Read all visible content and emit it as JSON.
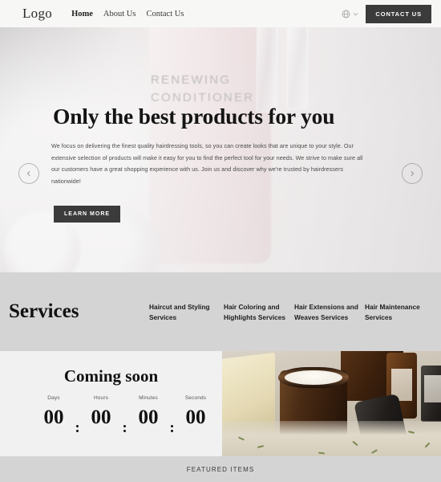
{
  "header": {
    "logo": "Logo",
    "nav": [
      {
        "label": "Home",
        "active": true
      },
      {
        "label": "About Us",
        "active": false
      },
      {
        "label": "Contact Us",
        "active": false
      }
    ],
    "language_icon": "globe-icon",
    "chevron_icon": "chevron-down-icon",
    "cta_label": "CONTACT US"
  },
  "hero": {
    "background_label_line1": "RENEWING",
    "background_label_line2": "CONDITIONER",
    "title": "Only the best products for you",
    "paragraph": "We focus on delivering the finest quality hairdressing tools, so you can create looks that are unique to your style. Our extensive selection of products will make it easy for you to find the perfect tool for your needs. We strive to make sure all our customers have a great shopping experience with us. Join us and discover why we're trusted by hairdressers nationwide!",
    "cta_label": "LEARN MORE",
    "prev_icon": "chevron-left-icon",
    "next_icon": "chevron-right-icon",
    "dots": [
      {
        "active": true
      },
      {
        "active": false
      },
      {
        "active": false
      }
    ]
  },
  "services": {
    "title": "Services",
    "items": [
      {
        "label": "Haircut and Styling Services"
      },
      {
        "label": "Hair Coloring and Highlights Services"
      },
      {
        "label": "Hair Extensions and Weaves Services"
      },
      {
        "label": "Hair Maintenance Services"
      }
    ]
  },
  "coming_soon": {
    "title": "Coming soon",
    "units": [
      {
        "label": "Days",
        "value": "00"
      },
      {
        "label": "Hours",
        "value": "00"
      },
      {
        "label": "Minutes",
        "value": "00"
      },
      {
        "label": "Seconds",
        "value": "00"
      }
    ],
    "separator": ":"
  },
  "product_photo": {
    "alt": "cosmetic jars, soap bar and dried herbs"
  },
  "footer": {
    "featured_label": "FEATURED ITEMS"
  },
  "colors": {
    "dark_button": "#3b3b3b",
    "band_gray": "#d4d4d4",
    "page_bg": "#f2f2f2",
    "header_bg": "#f7f7f6"
  }
}
